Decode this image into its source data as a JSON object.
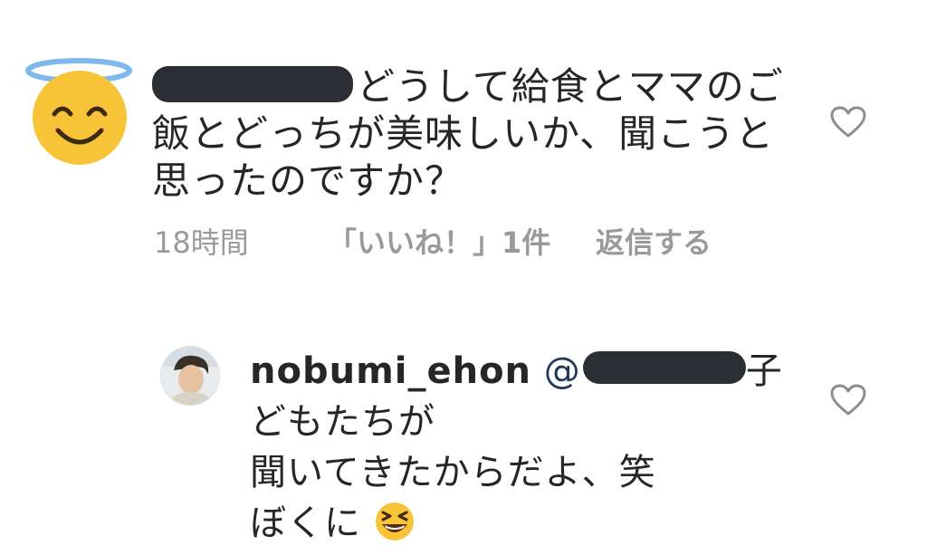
{
  "comment": {
    "text_line1": "どうして給食とママのご",
    "text_line2": "飯とどっちが美味しいか、聞こうと",
    "text_line3": "思ったのですか？",
    "time": "18時間",
    "likes": "「いいね！」1件",
    "reply_label": "返信する"
  },
  "reply": {
    "username": "nobumi_ehon",
    "mention_prefix": "@",
    "text_line1_end": "子",
    "text_line2": "どもたちが",
    "text_line3": "聞いてきたからだよ、笑",
    "text_line4": "ぼくに"
  },
  "icons": {
    "avatar": "smiling-face-with-halo-emoji",
    "heart": "heart-outline-icon",
    "laugh": "grinning-squinting-face-emoji"
  },
  "colors": {
    "meta_text": "#9a9a9a",
    "mention": "#21395c",
    "redaction": "#2b2f33",
    "emoji_yellow": "#f7c438",
    "halo_blue": "#7fb8ea"
  }
}
